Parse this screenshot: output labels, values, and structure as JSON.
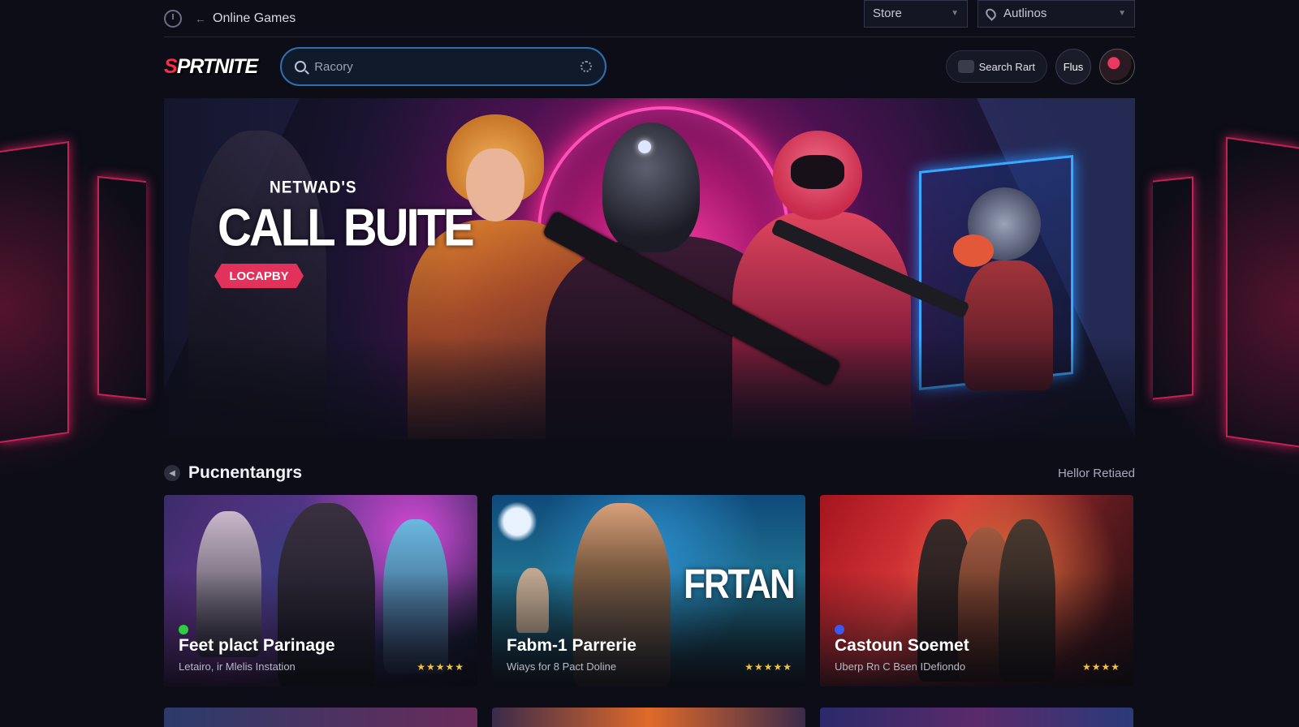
{
  "topbar": {
    "breadcrumb_arrow": "←",
    "breadcrumb": "Online Games",
    "store_dropdown": "Store",
    "location_dropdown": "Autlinos"
  },
  "header": {
    "logo_s": "S",
    "logo_rest": "PRTNITE",
    "search_placeholder": "Racory",
    "search_pill": "Search Rart",
    "plus_button": "Flus"
  },
  "hero": {
    "kicker": "NETWAD'S",
    "title": "CALL BUITE",
    "badge": "LOCAPBY"
  },
  "section": {
    "title": "Pucnentangrs",
    "link": "Hellor Retiaed"
  },
  "cards": [
    {
      "title": "Feet plact Parinage",
      "subtitle": "Letairo, ir Mlelis Instation",
      "rating": "★★★★★",
      "dot_color": "#2ecc40",
      "logo": ""
    },
    {
      "title": "Fabm-1 Parrerie",
      "subtitle": "Wiays for 8 Pact Doline",
      "rating": "★★★★★",
      "dot_color": "",
      "logo": "FRTAN"
    },
    {
      "title": "Castoun Soemet",
      "subtitle": "Uberp Rn C Bsen IDefiondo",
      "rating": "★★★★",
      "dot_color": "#3a5af0",
      "logo": ""
    }
  ],
  "icons": {
    "clock": "clock-icon",
    "search": "search-icon",
    "mic": "mic-icon",
    "pin": "location-pin-icon",
    "chevron": "chevron-down-icon"
  },
  "colors": {
    "accent": "#e2315a",
    "search_border": "#2f6fb0",
    "background": "#0c0d17",
    "star": "#f5c23a"
  }
}
